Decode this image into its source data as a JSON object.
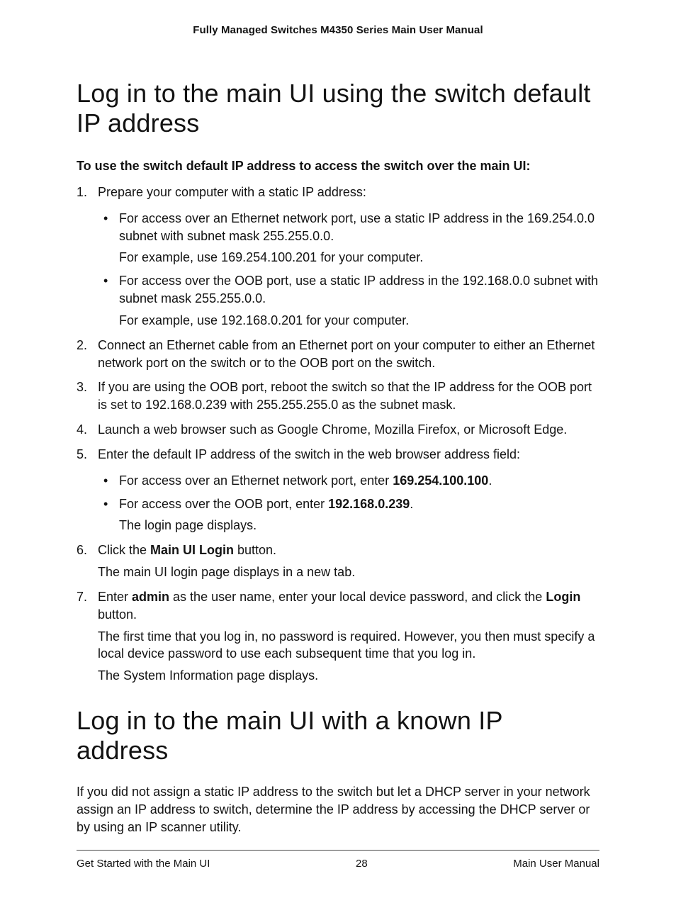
{
  "header": {
    "title": "Fully Managed Switches M4350 Series Main User Manual"
  },
  "section1": {
    "title": "Log in to the main UI using the switch default IP address",
    "intro": "To use the switch default IP address to access the switch over the main UI:",
    "steps": {
      "s1": {
        "main": "Prepare your computer with a static IP address:",
        "bullets": {
          "b1": {
            "main": "For access over an Ethernet network port, use a static IP address in the 169.254.0.0 subnet with subnet mask 255.255.0.0.",
            "follow": "For example, use 169.254.100.201 for your computer."
          },
          "b2": {
            "main": "For access over the OOB port, use a static IP address in the 192.168.0.0 subnet with subnet mask 255.255.0.0.",
            "follow": "For example, use 192.168.0.201 for your computer."
          }
        }
      },
      "s2": {
        "main": "Connect an Ethernet cable from an Ethernet port on your computer to either an Ethernet network port on the switch or to the OOB port on the switch."
      },
      "s3": {
        "main": "If you are using the OOB port, reboot the switch so that the IP address for the OOB port is set to 192.168.0.239 with 255.255.255.0 as the subnet mask."
      },
      "s4": {
        "main": "Launch a web browser such as Google Chrome, Mozilla Firefox, or Microsoft Edge."
      },
      "s5": {
        "main": "Enter the default IP address of the switch in the web browser address field:",
        "bullets": {
          "b1": {
            "pre": "For access over an Ethernet network port, enter ",
            "bold": "169.254.100.100",
            "post": "."
          },
          "b2": {
            "pre": "For access over the OOB port, enter ",
            "bold": "192.168.0.239",
            "post": ".",
            "follow": "The login page displays."
          }
        }
      },
      "s6": {
        "pre": "Click the ",
        "bold": "Main UI Login",
        "post": " button.",
        "follow": "The main UI login page displays in a new tab."
      },
      "s7": {
        "pre": "Enter ",
        "bold1": "admin",
        "mid": " as the user name, enter your local device password, and click the ",
        "bold2": "Login",
        "post": " button.",
        "follow1": "The first time that you log in, no password is required. However, you then must specify a local device password to use each subsequent time that you log in.",
        "follow2": "The System Information page displays."
      }
    }
  },
  "section2": {
    "title": "Log in to the main UI with a known IP address",
    "para": "If you did not assign a static IP address to the switch but let a DHCP server in your network assign an IP address to switch, determine the IP address by accessing the DHCP server or by using an IP scanner utility."
  },
  "footer": {
    "left": "Get Started with the Main UI",
    "center": "28",
    "right": "Main User Manual"
  }
}
